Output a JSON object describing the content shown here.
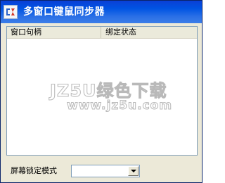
{
  "window": {
    "title": "多窗口键鼠同步器",
    "icon": "app-icon"
  },
  "list": {
    "columns": [
      "窗口句柄",
      "绑定状态"
    ],
    "rows": []
  },
  "watermark": {
    "main": "JZ5U绿色下载",
    "sub": "www.jz5u.com"
  },
  "lock_mode": {
    "label": "屏幕锁定模式",
    "value": ""
  },
  "colors": {
    "titlebar": "#0054e3",
    "window_bg": "#ece9d8",
    "list_border": "#7f9db9"
  }
}
